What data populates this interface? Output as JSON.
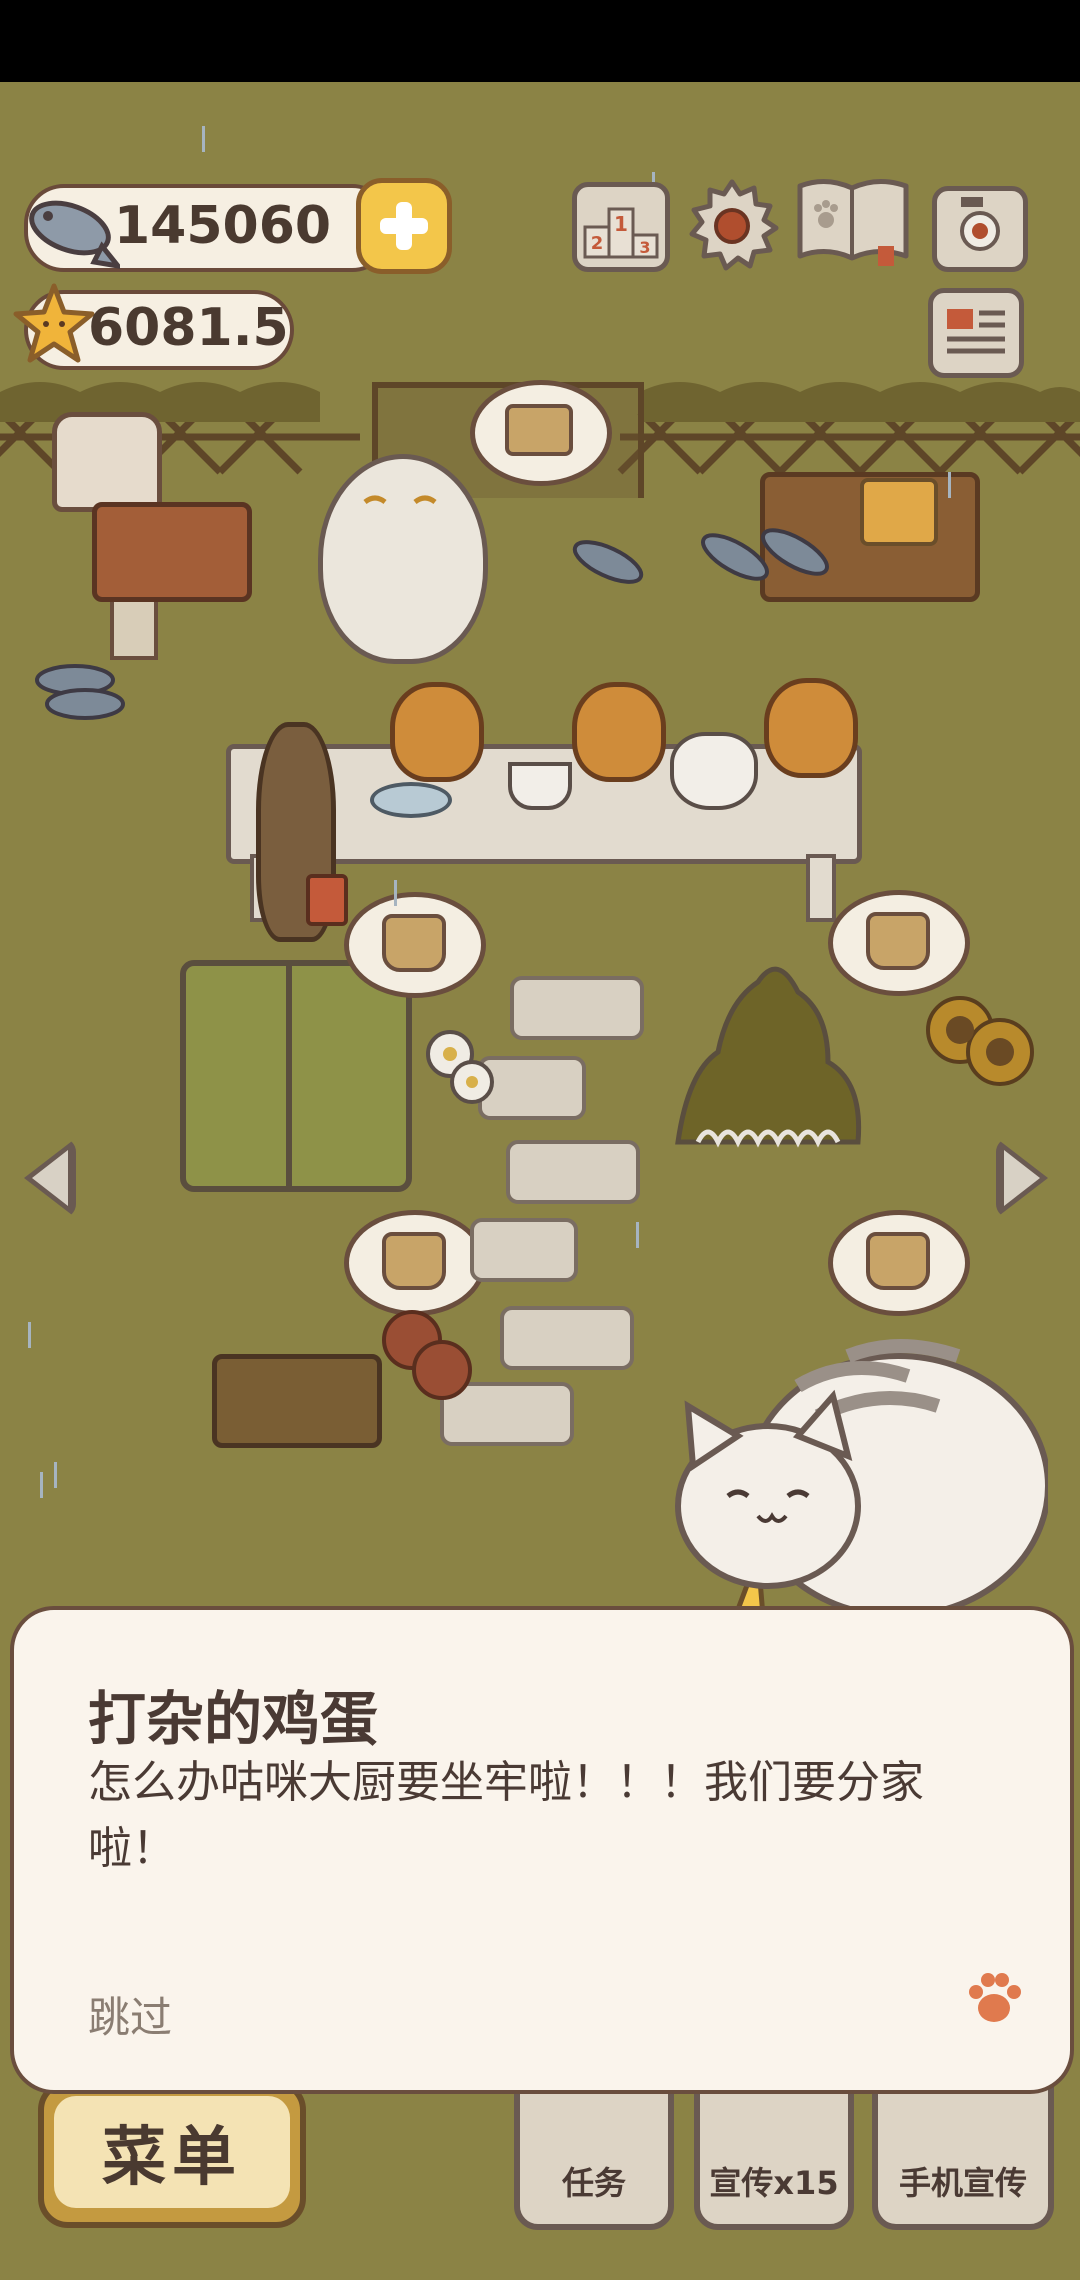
{
  "currency": {
    "fish": "145060",
    "stars": "6081.5"
  },
  "dialog": {
    "speaker": "打杂的鸡蛋",
    "text": "怎么办咕咪大厨要坐牢啦！！！我们要分家啦！",
    "skip": "跳过"
  },
  "bottom_bar": {
    "menu": "菜单",
    "tasks": "任务",
    "promote": "宣传x15",
    "phone_promote": "手机宣传"
  },
  "icons": {
    "fish": "fish-icon",
    "star": "star-icon",
    "plus": "plus-icon",
    "ranking": "ranking-podium-icon",
    "settings": "gear-icon",
    "book": "paw-book-icon",
    "camera": "camera-icon",
    "newspaper": "newspaper-icon",
    "paw": "paw-icon"
  },
  "colors": {
    "background": "#8b8345",
    "dialog_bg": "#faf4ec",
    "accent_yellow": "#f3c64a",
    "paw_orange": "#e07a4e"
  }
}
